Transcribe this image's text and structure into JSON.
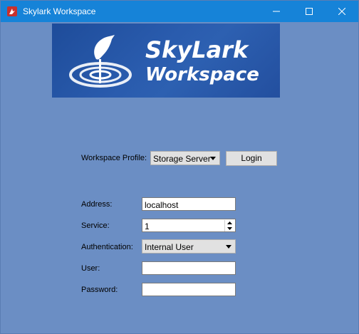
{
  "window": {
    "title": "Skylark Workspace",
    "accent": "#1683d8",
    "background": "#6b8ec4"
  },
  "banner": {
    "line1": "SkyLark",
    "line2": "Workspace",
    "background": "#2a5cae"
  },
  "profile": {
    "label": "Workspace Profile:",
    "selected": "Storage Server",
    "login_label": "Login"
  },
  "form": {
    "address_label": "Address:",
    "address_value": "localhost",
    "service_label": "Service:",
    "service_value": "1",
    "auth_label": "Authentication:",
    "auth_selected": "Internal User",
    "user_label": "User:",
    "user_value": "",
    "password_label": "Password:",
    "password_value": ""
  },
  "icons": {
    "app": "skylark-app-icon",
    "minimize": "minimize-icon",
    "maximize": "maximize-icon",
    "close": "close-icon",
    "dropdown": "chevron-down-icon"
  }
}
